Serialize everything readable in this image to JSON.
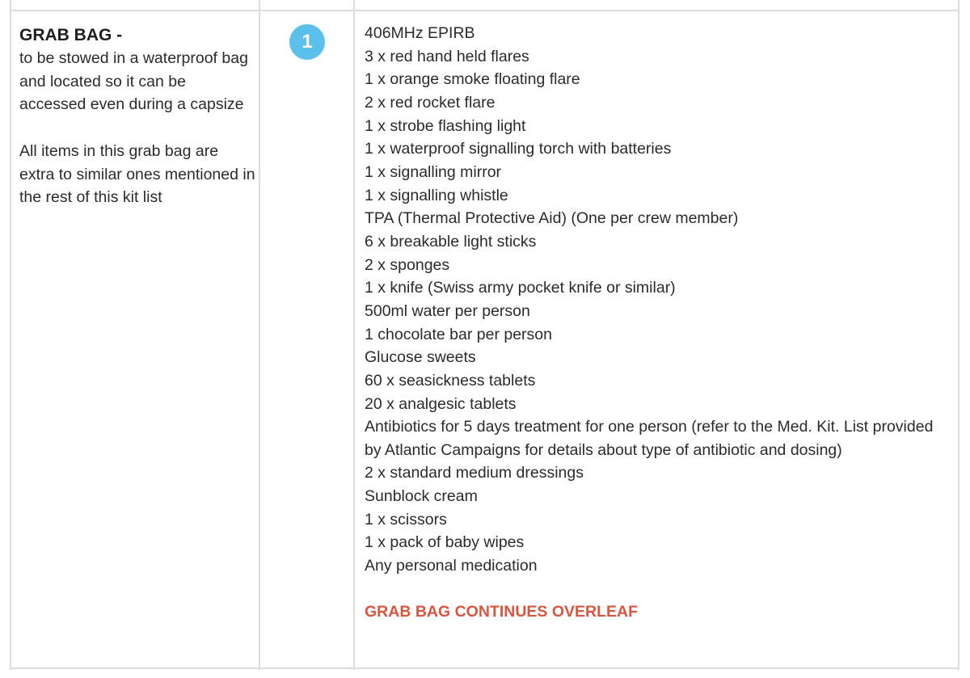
{
  "section": {
    "title": "GRAB BAG -",
    "description": "to be stowed in a waterproof bag and located so it can be accessed even during a capsize",
    "note": "All items in this grab bag are extra to similar ones mentioned in the rest of this kit list",
    "number": "1",
    "badge_color": "#5bbfec",
    "items": [
      "406MHz EPIRB",
      "3 x red hand held flares",
      "1 x orange smoke floating flare",
      "2 x red rocket flare",
      "1 x strobe flashing light",
      "1 x waterproof signalling torch with batteries",
      "1 x signalling mirror",
      "1 x signalling whistle",
      "TPA (Thermal Protective Aid) (One per crew member)",
      "6 x breakable light sticks",
      "2 x sponges",
      "1 x knife (Swiss army pocket knife or similar)",
      "500ml water per person",
      "1 chocolate bar per person",
      "Glucose sweets",
      "60 x seasickness tablets",
      "20 x analgesic tablets",
      "Antibiotics for 5 days treatment for one person (refer to the Med. Kit. List provided by Atlantic Campaigns for details about type of antibiotic and dosing)",
      "2 x standard medium dressings",
      "Sunblock cream",
      "1 x scissors",
      "1 x pack of baby wipes",
      "Any personal medication"
    ],
    "continues_note": "GRAB BAG CONTINUES OVERLEAF",
    "continues_color": "#d9563e"
  }
}
